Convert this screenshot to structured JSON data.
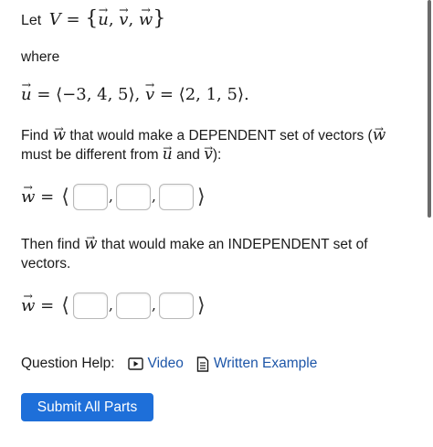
{
  "intro": {
    "let_text": "Let",
    "set_expr_lhs": "V",
    "set_vectors": [
      "u",
      "v",
      "w"
    ]
  },
  "where_text": "where",
  "given": {
    "u_name": "u",
    "u_components": "−3, 4, 5",
    "v_name": "v",
    "v_components": "2, 1, 5"
  },
  "dependent_prompt": {
    "part1": "Find",
    "vec": "w",
    "part2": "that would make a DEPENDENT set of vectors (",
    "part3": "must be different from",
    "and_text": "and",
    "end": "):"
  },
  "answer1": {
    "label": "w",
    "fields": [
      "",
      "",
      ""
    ]
  },
  "independent_prompt": {
    "part1": "Then find",
    "vec": "w",
    "part2": "that would make an INDEPENDENT set of vectors."
  },
  "answer2": {
    "label": "w",
    "fields": [
      "",
      "",
      ""
    ]
  },
  "help": {
    "label": "Question Help:",
    "video_label": "Video",
    "example_label": "Written Example"
  },
  "submit_label": "Submit All Parts",
  "colors": {
    "link": "#1d56a8",
    "button": "#1e6fd9",
    "scrollbar": "#6b6b6b"
  }
}
